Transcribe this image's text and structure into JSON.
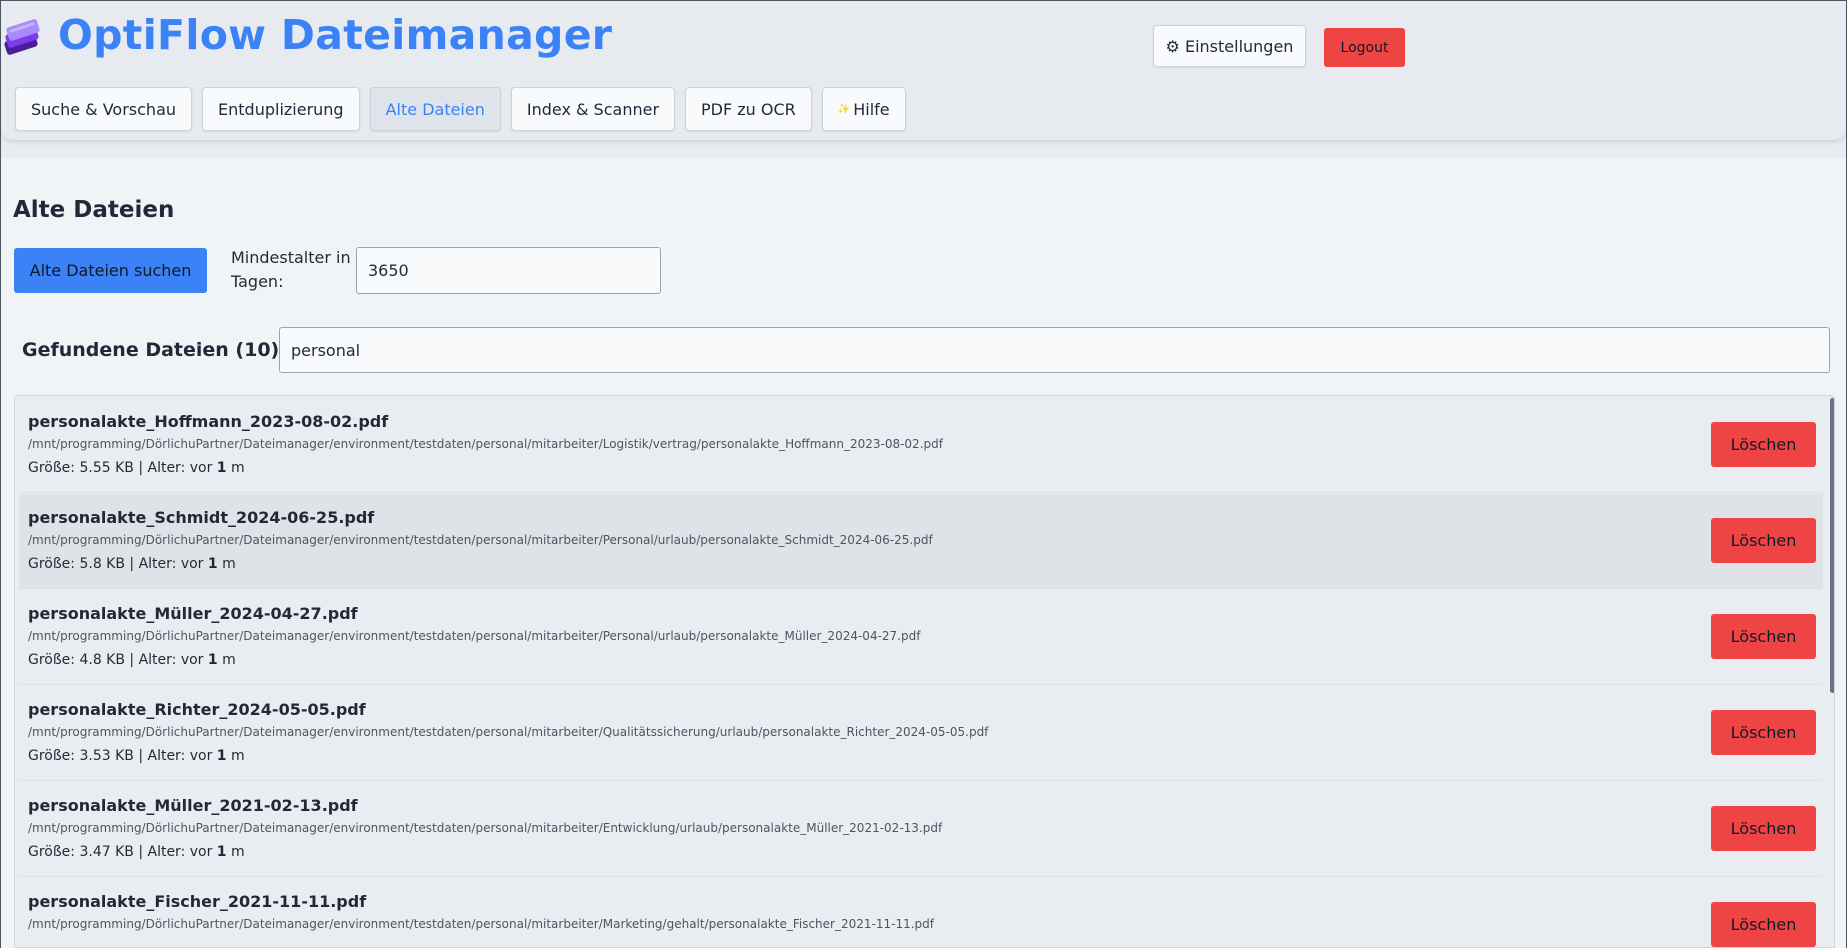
{
  "app": {
    "title": "OptiFlow Dateimanager"
  },
  "header": {
    "settings_label": "⚙ Einstellungen",
    "logout_label": "Logout"
  },
  "tabs": [
    {
      "label": "Suche & Vorschau",
      "active": false
    },
    {
      "label": "Entduplizierung",
      "active": false
    },
    {
      "label": "Alte Dateien",
      "active": true
    },
    {
      "label": "Index & Scanner",
      "active": false
    },
    {
      "label": "PDF zu OCR",
      "active": false
    },
    {
      "label": "Hilfe",
      "active": false,
      "icon": "sparkle-icon"
    }
  ],
  "main": {
    "title": "Alte Dateien",
    "search_button_label": "Alte Dateien suchen",
    "min_age_label": "Mindestalter in Tagen:",
    "min_age_value": "3650",
    "found_label": "Gefundene Dateien (10):",
    "filter_value": "personal",
    "delete_label": "Löschen"
  },
  "files": [
    {
      "name": "personalakte_Hoffmann_2023-08-02.pdf",
      "path": "/mnt/programming/DörlichuPartner/Dateimanager/environment/testdaten/personal/mitarbeiter/Logistik/vertrag/personalakte_Hoffmann_2023-08-02.pdf",
      "size_label": "Größe: 5.55 KB | Alter: vor ",
      "age_value": "1",
      "age_unit": " m"
    },
    {
      "name": "personalakte_Schmidt_2024-06-25.pdf",
      "path": "/mnt/programming/DörlichuPartner/Dateimanager/environment/testdaten/personal/mitarbeiter/Personal/urlaub/personalakte_Schmidt_2024-06-25.pdf",
      "size_label": "Größe: 5.8 KB | Alter: vor ",
      "age_value": "1",
      "age_unit": " m"
    },
    {
      "name": "personalakte_Müller_2024-04-27.pdf",
      "path": "/mnt/programming/DörlichuPartner/Dateimanager/environment/testdaten/personal/mitarbeiter/Personal/urlaub/personalakte_Müller_2024-04-27.pdf",
      "size_label": "Größe: 4.8 KB | Alter: vor ",
      "age_value": "1",
      "age_unit": " m"
    },
    {
      "name": "personalakte_Richter_2024-05-05.pdf",
      "path": "/mnt/programming/DörlichuPartner/Dateimanager/environment/testdaten/personal/mitarbeiter/Qualitätssicherung/urlaub/personalakte_Richter_2024-05-05.pdf",
      "size_label": "Größe: 3.53 KB | Alter: vor ",
      "age_value": "1",
      "age_unit": " m"
    },
    {
      "name": "personalakte_Müller_2021-02-13.pdf",
      "path": "/mnt/programming/DörlichuPartner/Dateimanager/environment/testdaten/personal/mitarbeiter/Entwicklung/urlaub/personalakte_Müller_2021-02-13.pdf",
      "size_label": "Größe: 3.47 KB | Alter: vor ",
      "age_value": "1",
      "age_unit": " m"
    },
    {
      "name": "personalakte_Fischer_2021-11-11.pdf",
      "path": "/mnt/programming/DörlichuPartner/Dateimanager/environment/testdaten/personal/mitarbeiter/Marketing/gehalt/personalakte_Fischer_2021-11-11.pdf",
      "size_label": "",
      "age_value": "",
      "age_unit": ""
    }
  ],
  "colors": {
    "accent": "#3b82f6",
    "danger": "#ef4444",
    "background": "#f1f4f7"
  }
}
